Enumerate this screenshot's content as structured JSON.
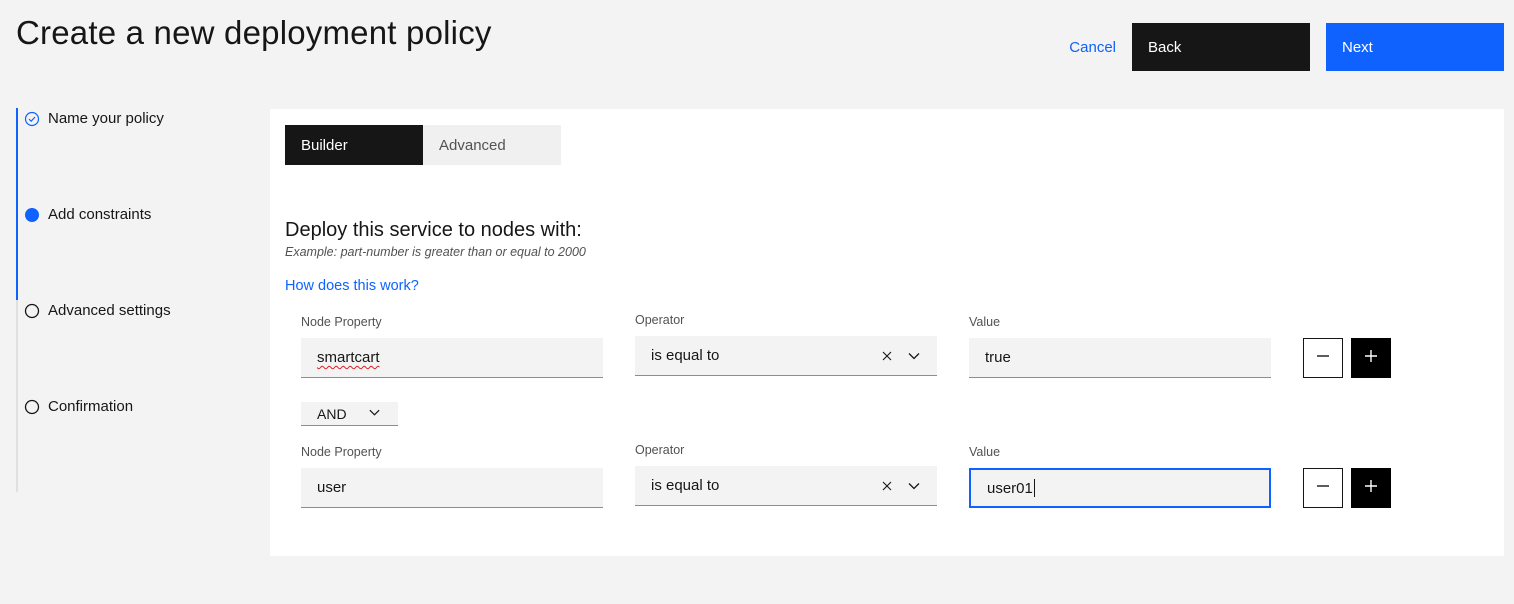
{
  "page_title": "Create a new deployment policy",
  "header": {
    "cancel_label": "Cancel",
    "back_label": "Back",
    "next_label": "Next"
  },
  "progress": {
    "steps": [
      {
        "label": "Name your policy",
        "state": "complete"
      },
      {
        "label": "Add constraints",
        "state": "current"
      },
      {
        "label": "Advanced settings",
        "state": "incomplete"
      },
      {
        "label": "Confirmation",
        "state": "incomplete"
      }
    ]
  },
  "switcher": {
    "tabs": [
      {
        "label": "Builder",
        "selected": true
      },
      {
        "label": "Advanced",
        "selected": false
      }
    ]
  },
  "section": {
    "title": "Deploy this service to nodes with:",
    "example": "Example: part-number is greater than or equal to 2000",
    "help_link": "How does this work?"
  },
  "constraints": [
    {
      "property_label": "Node Property",
      "property_value": "smartcart",
      "operator_label": "Operator",
      "operator_value": "is equal to",
      "value_label": "Value",
      "value": "true"
    },
    {
      "property_label": "Node Property",
      "property_value": "user",
      "operator_label": "Operator",
      "operator_value": "is equal to",
      "value_label": "Value",
      "value": "user01"
    }
  ],
  "conjunction": {
    "value": "AND"
  },
  "colors": {
    "accent": "#0f62fe",
    "dark": "#161616",
    "background": "#f3f3f3"
  },
  "icons": {
    "complete_step": "checkmark-outline-icon",
    "current_step": "filled-circle-icon",
    "incomplete_step": "circle-outline-icon",
    "clear": "close-icon",
    "dropdown": "chevron-down-icon",
    "remove_row": "subtract-icon",
    "add_row": "add-icon"
  }
}
